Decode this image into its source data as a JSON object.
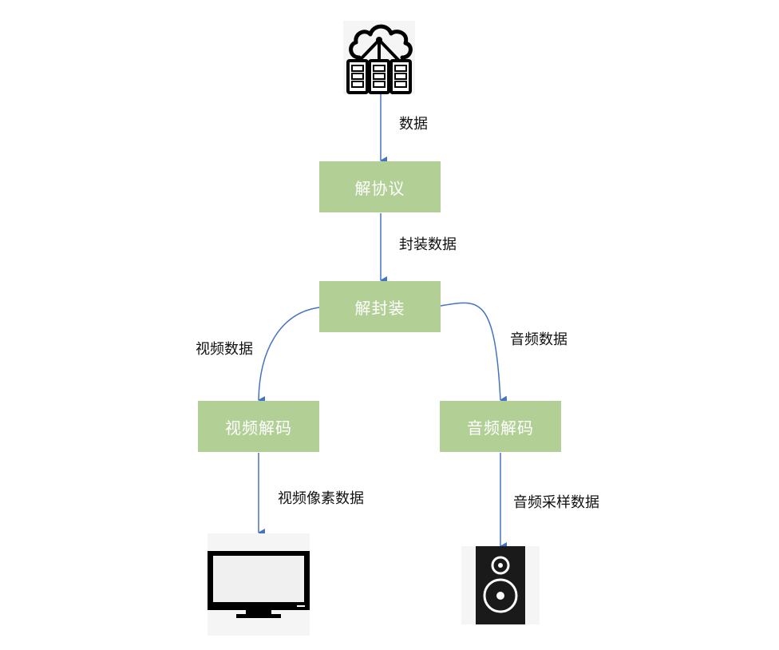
{
  "nodes": {
    "protocol": "解协议",
    "demux": "解封装",
    "video_decode": "视频解码",
    "audio_decode": "音频解码"
  },
  "edges": {
    "data": "数据",
    "container_data": "封装数据",
    "video_data": "视频数据",
    "audio_data": "音频数据",
    "video_pixel_data": "视频像素数据",
    "audio_sample_data": "音频采样数据"
  },
  "icons": {
    "source": "cloud-server-icon",
    "video_output": "monitor-icon",
    "audio_output": "speaker-icon"
  },
  "colors": {
    "node_fill": "#b2d096",
    "node_text": "#ffffff",
    "arrow": "#4472c4"
  }
}
